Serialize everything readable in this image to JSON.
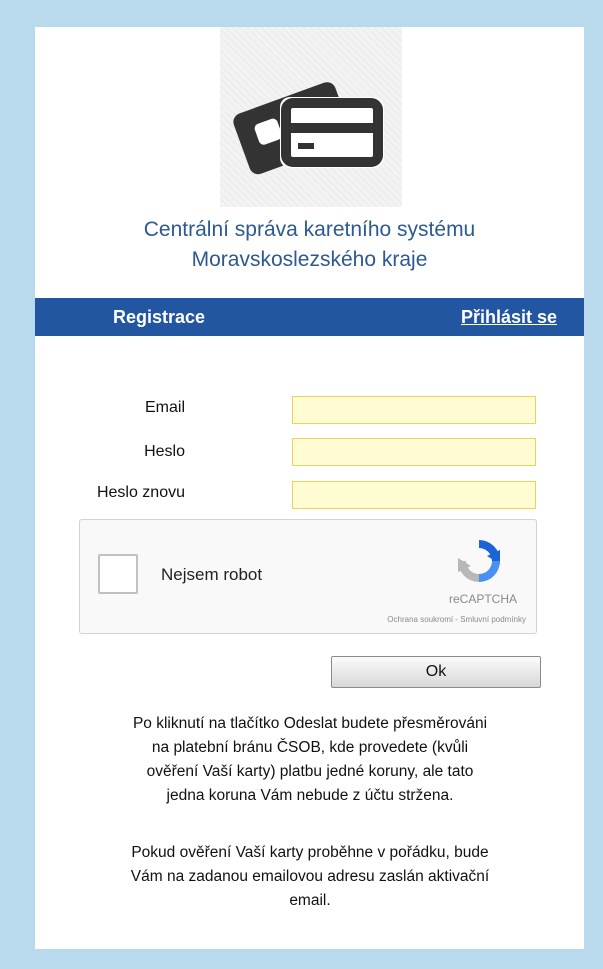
{
  "header": {
    "title_line1": "Centrální správa karetního systému",
    "title_line2": "Moravskoslezského kraje"
  },
  "nav": {
    "register_label": "Registrace",
    "login_label": "Přihlásit se"
  },
  "form": {
    "email_label": "Email",
    "email_value": "",
    "password_label": "Heslo",
    "password_value": "",
    "password_repeat_label": "Heslo znovu",
    "password_repeat_value": ""
  },
  "captcha": {
    "label": "Nejsem robot",
    "brand": "reCAPTCHA",
    "links": "Ochrana soukromí - Smluvní podmínky",
    "icon": "recaptcha-icon"
  },
  "submit": {
    "label": "Ok"
  },
  "info": {
    "paragraph1_lines": [
      "Po kliknutí na tlačítko Odeslat budete přesměrováni",
      "na platební bránu ČSOB, kde provedete (kvůli",
      "ověření Vaší karty) platbu jedné koruny, ale tato",
      "jedna koruna Vám nebude z účtu stržena."
    ],
    "paragraph2_lines": [
      "Pokud ověření Vaší karty proběhne v pořádku, bude",
      "Vám na zadanou emailovou adresu zaslán aktivační",
      "email."
    ]
  },
  "colors": {
    "background": "#b9d9ec",
    "nav_bar": "#2256a0",
    "title": "#2c5a90",
    "input_fill": "#fffbd3",
    "input_border": "#f0d25a"
  },
  "icons": {
    "logo": "cards-logo-icon"
  }
}
